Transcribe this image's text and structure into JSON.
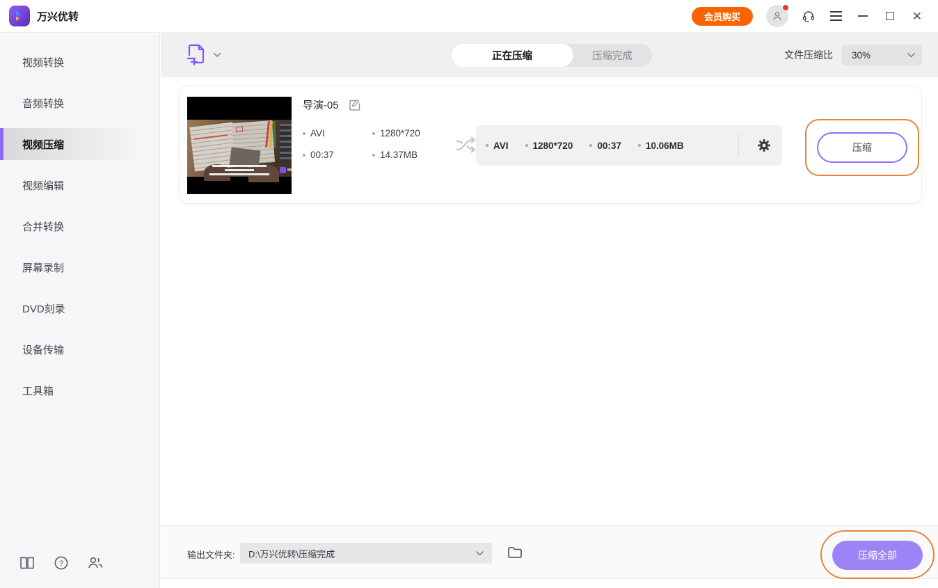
{
  "titlebar": {
    "app_name": "万兴优转",
    "buy_membership_label": "会员购买"
  },
  "sidebar": {
    "items": [
      {
        "label": "视频转换",
        "active": false
      },
      {
        "label": "音频转换",
        "active": false
      },
      {
        "label": "视频压缩",
        "active": true
      },
      {
        "label": "视频编辑",
        "active": false
      },
      {
        "label": "合并转换",
        "active": false
      },
      {
        "label": "屏幕录制",
        "active": false
      },
      {
        "label": "DVD刻录",
        "active": false
      },
      {
        "label": "设备传输",
        "active": false
      },
      {
        "label": "工具箱",
        "active": false
      }
    ]
  },
  "toolbar": {
    "tabs": [
      {
        "label": "正在压缩",
        "active": true
      },
      {
        "label": "压缩完成",
        "active": false
      }
    ],
    "compression_ratio_label": "文件压缩比",
    "compression_ratio_value": "30%"
  },
  "file_item": {
    "title": "导演-05",
    "source": {
      "format": "AVI",
      "resolution": "1280*720",
      "duration": "00:37",
      "size": "14.37MB"
    },
    "output": {
      "format": "AVI",
      "resolution": "1280*720",
      "duration": "00:37",
      "size": "10.06MB"
    },
    "compress_button_label": "压缩"
  },
  "footer": {
    "output_folder_label": "输出文件夹:",
    "output_folder_path": "D:\\万兴优转\\压缩完成",
    "compress_all_label": "压缩全部"
  },
  "colors": {
    "accent_purple": "#8f6ef6",
    "button_purple": "#9d84f6",
    "brand_orange": "#fa6400",
    "annotation_orange": "#e0873e"
  }
}
